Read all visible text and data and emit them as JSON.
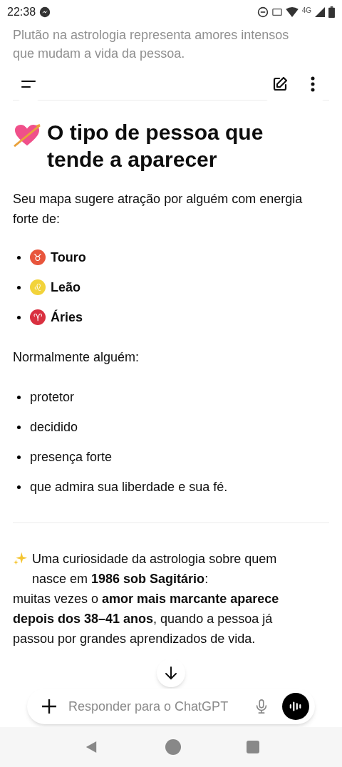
{
  "status_bar": {
    "time": "22:38",
    "network": "4G"
  },
  "faded_text": "Plutão na astrologia representa amores intensos que mudam a vida da pessoa.",
  "heading": "O tipo de pessoa que tende a aparecer",
  "intro": "Seu mapa sugere atração por alguém com energia forte de:",
  "signs": [
    {
      "symbol": "♉",
      "label": "Touro",
      "color": "#e8553c"
    },
    {
      "symbol": "♌",
      "label": "Leão",
      "color": "#f2d33a"
    },
    {
      "symbol": "♈",
      "label": "Áries",
      "color": "#d93040"
    }
  ],
  "traits_intro": "Normalmente alguém:",
  "traits": [
    "protetor",
    "decidido",
    "presença forte",
    "que admira sua liberdade e sua fé."
  ],
  "curiosity": [
    "Uma curiosidade da astrologia sobre quem nasce em **1986 sob Sagitário**:",
    "muitas vezes o **amor mais marcante aparece depois dos 38–41 anos**, quando a pessoa já passou por grandes aprendizados de vida."
  ],
  "composer": {
    "placeholder": "Responder para o ChatGPT"
  }
}
